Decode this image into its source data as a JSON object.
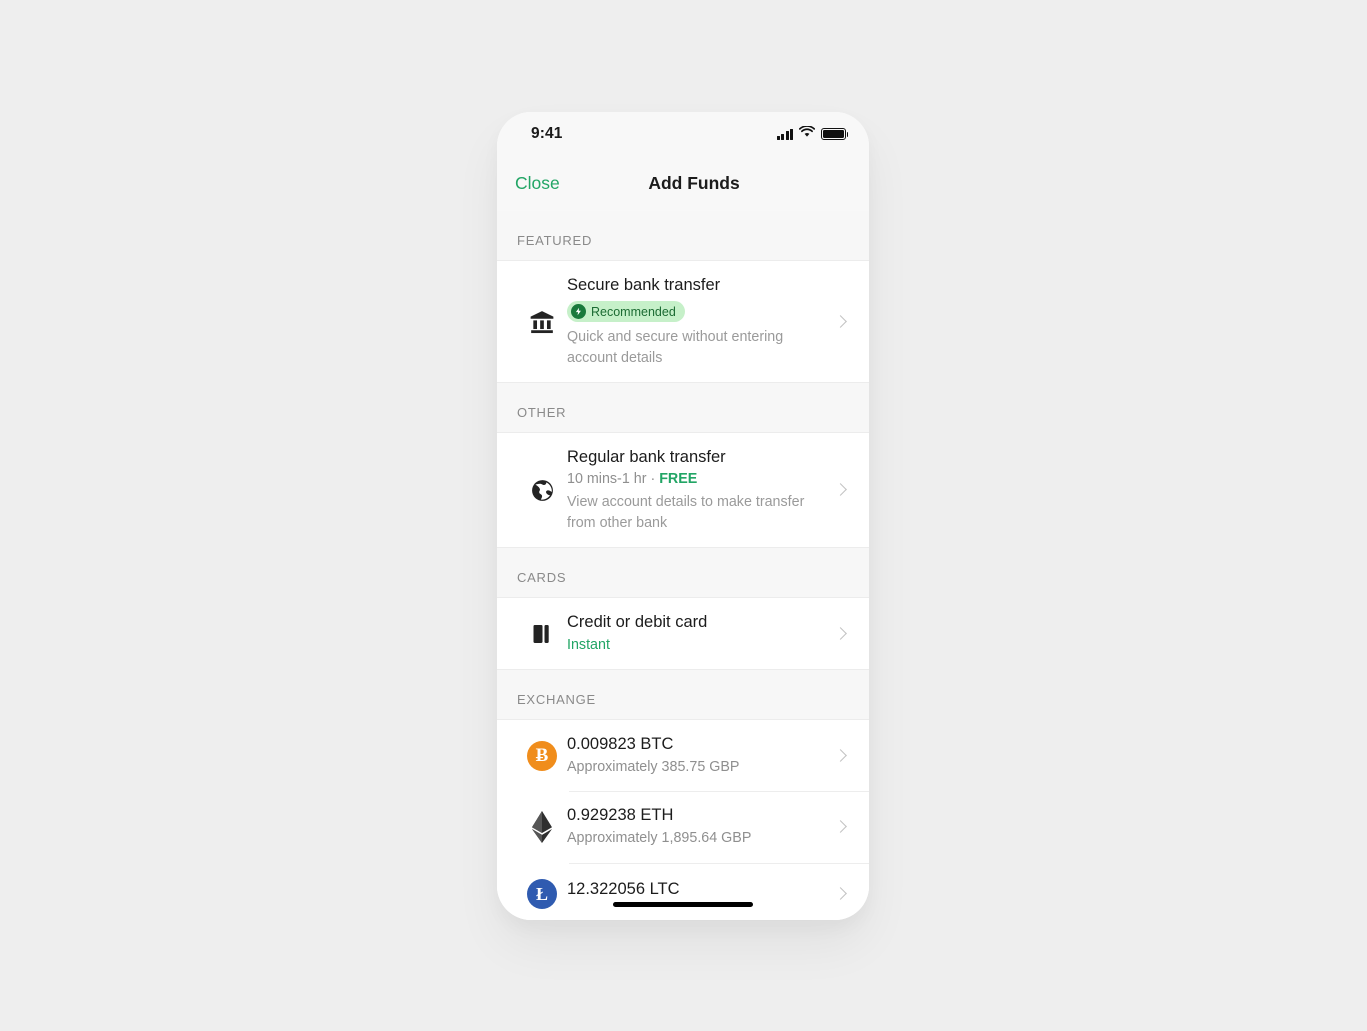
{
  "status_bar": {
    "time": "9:41",
    "signal_icon": "cellular-signal-icon",
    "wifi_icon": "wifi-icon",
    "battery_icon": "battery-full-icon"
  },
  "nav": {
    "close_label": "Close",
    "title": "Add Funds"
  },
  "colors": {
    "accent_green": "#22a565",
    "badge_bg": "#c6f0c9",
    "badge_text": "#1c6b33",
    "badge_icon_bg": "#1a7a3c",
    "bitcoin_orange": "#f08d1c",
    "litecoin_blue": "#2f5bb0",
    "section_header_bg": "#f7f7f7",
    "muted_text": "#8f8f8f"
  },
  "sections": [
    {
      "header": "FEATURED",
      "rows": [
        {
          "icon": "bank-building-icon",
          "title": "Secure bank transfer",
          "badge": {
            "label": "Recommended",
            "icon": "lightning-bolt-icon"
          },
          "description": "Quick and secure without entering account details"
        }
      ]
    },
    {
      "header": "OTHER",
      "rows": [
        {
          "icon": "globe-icon",
          "title": "Regular bank transfer",
          "meta_time": "10 mins-1 hr",
          "meta_separator": " · ",
          "meta_fee": "FREE",
          "description": "View account details to make transfer from other bank"
        }
      ]
    },
    {
      "header": "CARDS",
      "rows": [
        {
          "icon": "credit-card-icon",
          "title": "Credit or debit card",
          "subtitle": "Instant"
        }
      ]
    },
    {
      "header": "EXCHANGE",
      "rows": [
        {
          "icon": "bitcoin-icon",
          "icon_glyph": "Ƀ",
          "title": "0.009823 BTC",
          "subtitle": "Approximately 385.75 GBP"
        },
        {
          "icon": "ethereum-icon",
          "title": "0.929238 ETH",
          "subtitle": "Approximately 1,895.64 GBP"
        },
        {
          "icon": "litecoin-icon",
          "icon_glyph": "Ł",
          "title": "12.322056 LTC"
        }
      ]
    }
  ]
}
